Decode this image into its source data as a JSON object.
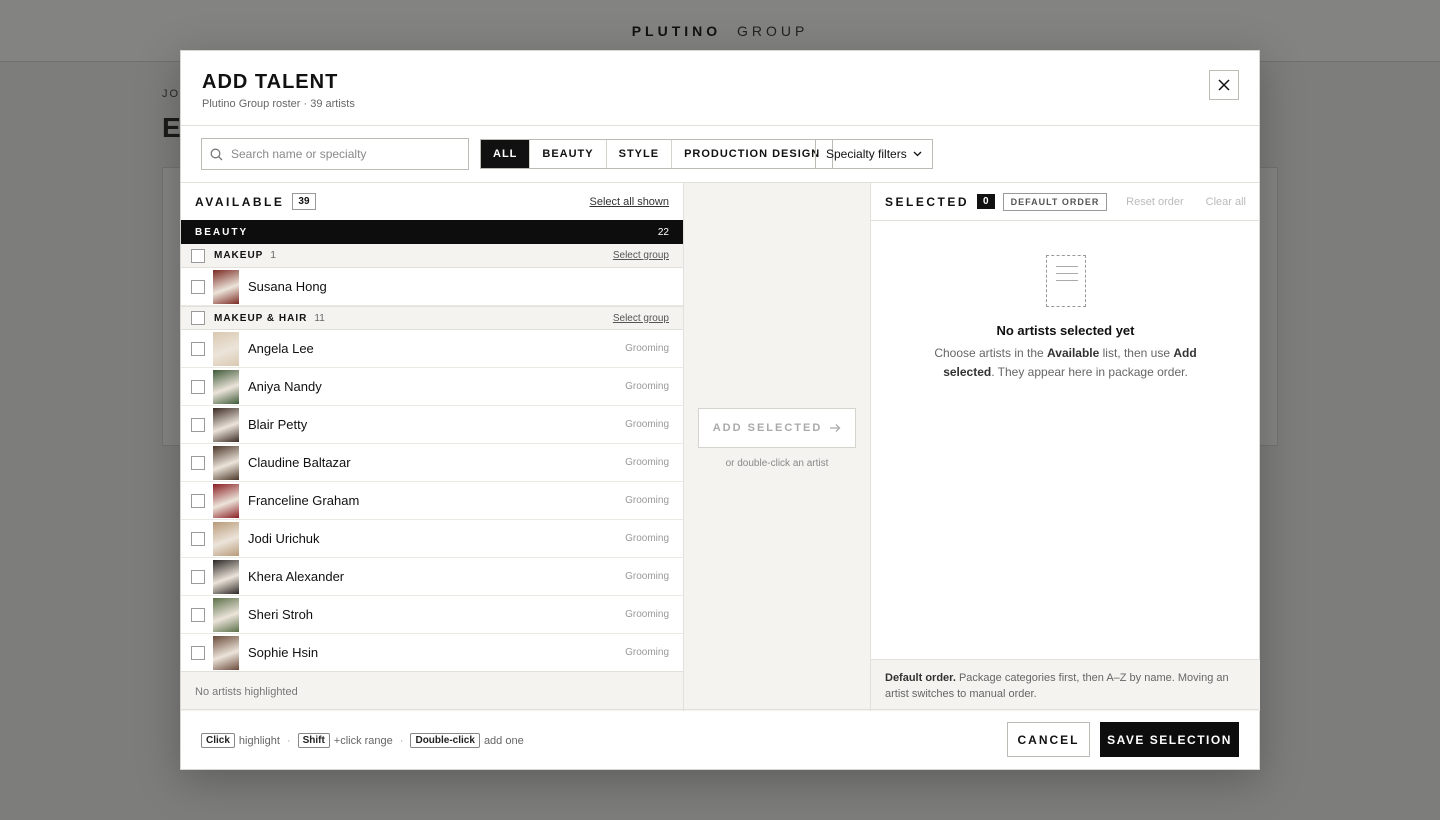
{
  "background": {
    "brand_bold": "PLUTINO",
    "brand_thin": "GROUP",
    "crumb": "JO",
    "title": "E"
  },
  "modal": {
    "title": "ADD TALENT",
    "subtitle": "Plutino Group roster · 39 artists",
    "close_icon": "close-icon"
  },
  "toolbar": {
    "search_placeholder": "Search name or specialty",
    "tabs": [
      {
        "label": "ALL",
        "active": true
      },
      {
        "label": "BEAUTY",
        "active": false
      },
      {
        "label": "STYLE",
        "active": false
      },
      {
        "label": "PRODUCTION DESIGN",
        "active": false
      }
    ],
    "specialty_label": "Specialty filters"
  },
  "available": {
    "title": "AVAILABLE",
    "count": "39",
    "select_all": "Select all shown",
    "group": {
      "name": "BEAUTY",
      "count": "22"
    },
    "subgroups": [
      {
        "name": "MAKEUP",
        "count": "1",
        "link": "Select group",
        "artists": [
          {
            "name": "Susana Hong",
            "tag": "",
            "color": "#7a2a22"
          }
        ]
      },
      {
        "name": "MAKEUP & HAIR",
        "count": "11",
        "link": "Select group",
        "artists": [
          {
            "name": "Angela Lee",
            "tag": "Grooming",
            "color": "#d9c8b0"
          },
          {
            "name": "Aniya Nandy",
            "tag": "Grooming",
            "color": "#3e5a38"
          },
          {
            "name": "Blair Petty",
            "tag": "Grooming",
            "color": "#3a2a24"
          },
          {
            "name": "Claudine Baltazar",
            "tag": "Grooming",
            "color": "#4a3628"
          },
          {
            "name": "Franceline Graham",
            "tag": "Grooming",
            "color": "#8a1e22"
          },
          {
            "name": "Jodi Urichuk",
            "tag": "Grooming",
            "color": "#b89a78"
          },
          {
            "name": "Khera Alexander",
            "tag": "Grooming",
            "color": "#2a2624"
          },
          {
            "name": "Sheri Stroh",
            "tag": "Grooming",
            "color": "#5a7048"
          },
          {
            "name": "Sophie Hsin",
            "tag": "Grooming",
            "color": "#6a4a3a"
          }
        ]
      }
    ],
    "footer": "No artists highlighted"
  },
  "middle": {
    "add_label": "ADD SELECTED",
    "hint": "or double-click an artist"
  },
  "selected": {
    "title": "SELECTED",
    "count": "0",
    "order_badge": "DEFAULT ORDER",
    "reset": "Reset order",
    "clear": "Clear all",
    "empty_title": "No artists selected yet",
    "empty_p1": "Choose artists in the ",
    "empty_b1": "Available",
    "empty_p2": " list, then use ",
    "empty_b2": "Add selected",
    "empty_p3": ". They appear here in package order.",
    "foot_bold": "Default order.",
    "foot_text": " Package categories first, then A–Z by name. Moving an artist switches to manual order."
  },
  "footer": {
    "hints": [
      {
        "key": "Click",
        "text": "highlight"
      },
      {
        "key": "Shift",
        "text": "+click range"
      },
      {
        "key": "Double-click",
        "text": "add one"
      }
    ],
    "cancel": "CANCEL",
    "save": "SAVE SELECTION"
  }
}
